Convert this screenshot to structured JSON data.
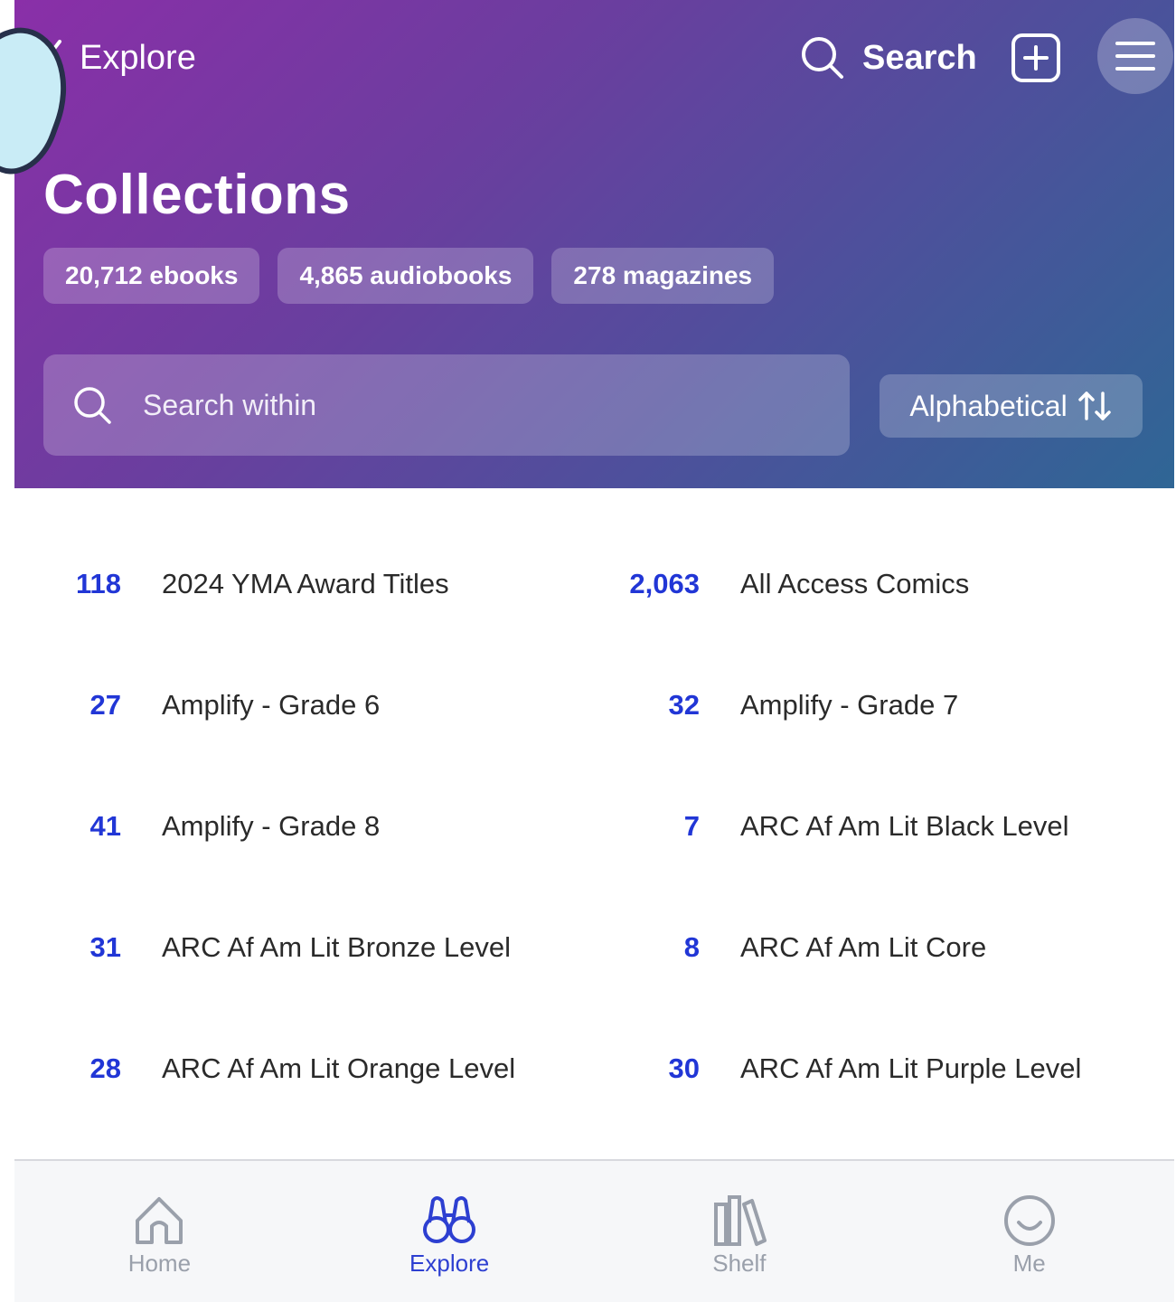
{
  "header": {
    "back_label": "Explore",
    "search_label": "Search"
  },
  "hero": {
    "title": "Collections",
    "chips": [
      "20,712 ebooks",
      "4,865 audiobooks",
      "278 magazines"
    ],
    "search_placeholder": "Search within",
    "sort_label": "Alphabetical"
  },
  "collections": [
    [
      {
        "count": "118",
        "name": "2024 YMA Award Titles"
      },
      {
        "count": "2,063",
        "name": "All Access Comics"
      }
    ],
    [
      {
        "count": "27",
        "name": "Amplify - Grade 6"
      },
      {
        "count": "32",
        "name": "Amplify - Grade 7"
      }
    ],
    [
      {
        "count": "41",
        "name": "Amplify - Grade 8"
      },
      {
        "count": "7",
        "name": "ARC Af Am Lit Black Level"
      }
    ],
    [
      {
        "count": "31",
        "name": "ARC Af Am Lit Bronze Level"
      },
      {
        "count": "8",
        "name": "ARC Af Am Lit Core"
      }
    ],
    [
      {
        "count": "28",
        "name": "ARC Af Am Lit Orange Level"
      },
      {
        "count": "30",
        "name": "ARC Af Am Lit Purple Level"
      }
    ]
  ],
  "tabs": [
    {
      "label": "Home",
      "icon": "home-icon"
    },
    {
      "label": "Explore",
      "icon": "binoculars-icon",
      "active": true
    },
    {
      "label": "Shelf",
      "icon": "books-icon"
    },
    {
      "label": "Me",
      "icon": "smiley-icon"
    }
  ],
  "colors": {
    "accent_blue": "#2136d6",
    "tab_active": "#2d3fd1",
    "tab_inactive": "#9aa0ab",
    "hero_gradient_start": "#8a2fa8",
    "hero_gradient_end": "#2f6695"
  }
}
